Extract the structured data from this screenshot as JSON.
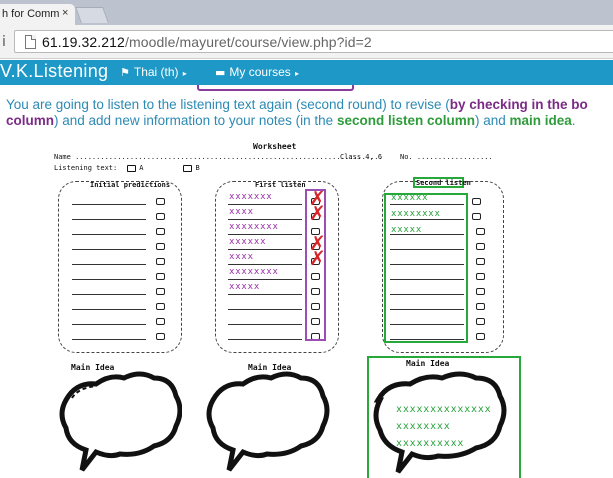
{
  "browser": {
    "tab_title": "h for Comm",
    "tab_close": "×",
    "url_host": "61.19.32.212",
    "url_path": "/moodle/mayuret/course/view.php?id=2"
  },
  "navbar": {
    "brand": "V.K.Listening",
    "lang_label": "Thai (th)",
    "courses_label": "My courses"
  },
  "instructions": {
    "part1": "You are going to listen to the listening text again (second round) to revise (",
    "bold1": "by checking in the bo",
    "bold1b": "column",
    "part2": ") and add new information to your notes (in the ",
    "bold2": "second listen column",
    "part3": ") and ",
    "bold3": "main idea",
    "part4": "."
  },
  "worksheet": {
    "title": "Worksheet",
    "name_label": "Name .........................................................................",
    "class_label": "Class 4, 6",
    "no_label": "No. ..................",
    "listening_label": "Listening text:",
    "option_a": "A",
    "option_b": "B",
    "col1_title": "Initial predictions",
    "col2_title": "First listen",
    "col3_title": "Second listen",
    "first_listen_notes": [
      "xxxxxxx",
      "xxxx",
      "xxxxxxxx",
      "xxxxxx",
      "xxxx",
      "xxxxxxxx",
      "xxxxx"
    ],
    "second_listen_notes": [
      "xxxxxx",
      "xxxxxxxx",
      "xxxxx"
    ],
    "main_idea_label": "Main Idea",
    "main_idea_notes": [
      "xxxxxxxxxxxxxx",
      "xxxxxxxx",
      "xxxxxxxxxx"
    ]
  },
  "colors": {
    "nav_blue": "#1d98c7",
    "instruction_blue": "#2c8ab5",
    "annotation_purple": "#9b2ea8",
    "annotation_green": "#25a13a",
    "annotation_red": "#d6272b"
  }
}
